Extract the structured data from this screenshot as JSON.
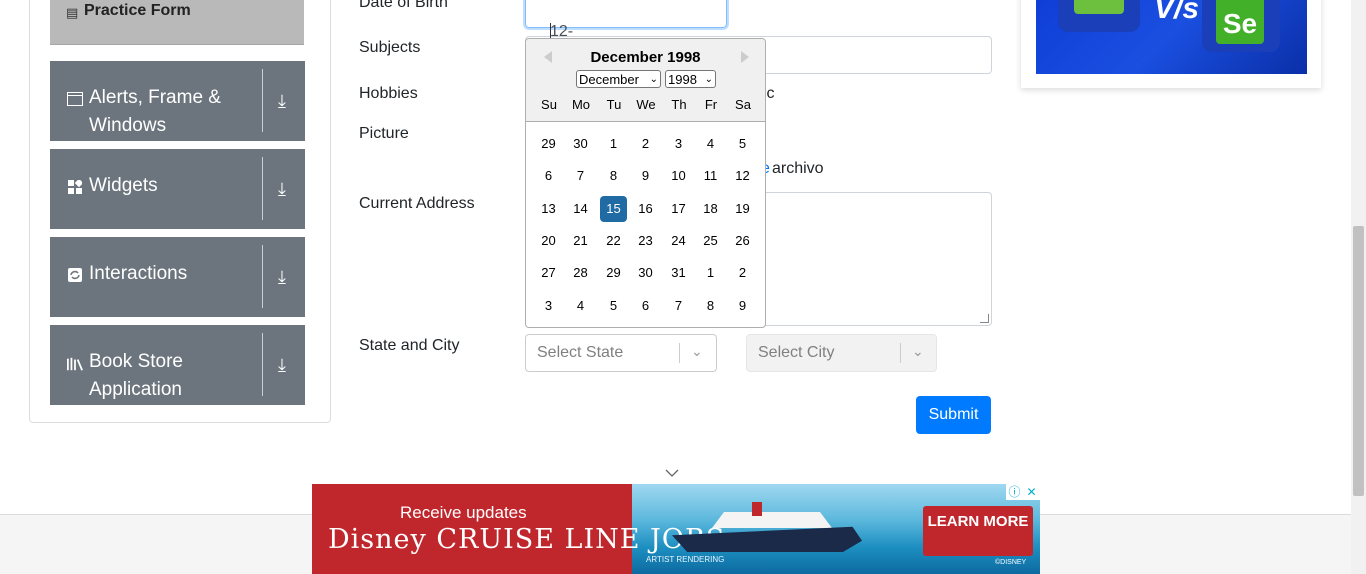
{
  "sidebar": {
    "practice_form": "Practice Form",
    "groups": [
      {
        "label": "Alerts, Frame & Windows",
        "icon": "window-icon"
      },
      {
        "label": "Widgets",
        "icon": "widgets-icon"
      },
      {
        "label": "Interactions",
        "icon": "interactions-icon"
      },
      {
        "label": "Book Store Application",
        "icon": "books-icon"
      }
    ]
  },
  "form": {
    "labels": {
      "dob": "Date of Birth",
      "subjects": "Subjects",
      "hobbies": "Hobbies",
      "picture": "Picture",
      "address": "Current Address",
      "state_city": "State and City"
    },
    "dob_value": "12-15-1998",
    "hobby_partial": "ic",
    "picture_partial": "archivo",
    "state_placeholder": "Select State",
    "city_placeholder": "Select City",
    "submit": "Submit"
  },
  "datepicker": {
    "title": "December 1998",
    "month_select": "December",
    "year_select": "1998",
    "weekdays": [
      "Su",
      "Mo",
      "Tu",
      "We",
      "Th",
      "Fr",
      "Sa"
    ],
    "weeks": [
      [
        "29",
        "30",
        "1",
        "2",
        "3",
        "4",
        "5"
      ],
      [
        "6",
        "7",
        "8",
        "9",
        "10",
        "11",
        "12"
      ],
      [
        "13",
        "14",
        "15",
        "16",
        "17",
        "18",
        "19"
      ],
      [
        "20",
        "21",
        "22",
        "23",
        "24",
        "25",
        "26"
      ],
      [
        "27",
        "28",
        "29",
        "30",
        "31",
        "1",
        "2"
      ],
      [
        "3",
        "4",
        "5",
        "6",
        "7",
        "8",
        "9"
      ]
    ],
    "selected": "15",
    "selected_color": "#216ba5"
  },
  "ad_top": {
    "vs_text": "V/s",
    "se_text": "Se"
  },
  "banner": {
    "line1": "Receive updates",
    "line2": "Disney CRUISE LINE JOBS",
    "cta": "LEARN MORE",
    "artist": "ARTIST RENDERING",
    "copyright": "©DISNEY"
  },
  "colors": {
    "sidebar_group": "#6c757d",
    "submit": "#007bff",
    "banner_red": "#c0272d"
  }
}
